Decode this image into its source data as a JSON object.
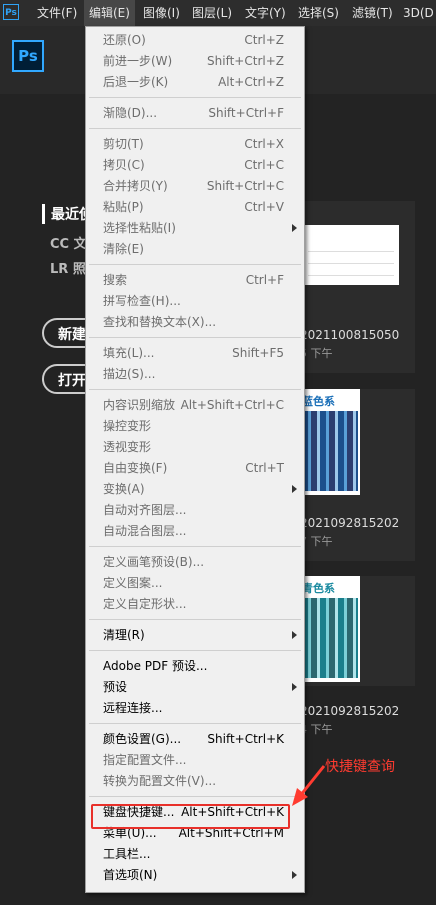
{
  "menubar": {
    "ps_badge": "Ps",
    "items": [
      {
        "label": "文件(F)",
        "active": false
      },
      {
        "label": "编辑(E)",
        "active": true
      },
      {
        "label": "图像(I)",
        "active": false
      },
      {
        "label": "图层(L)",
        "active": false
      },
      {
        "label": "文字(Y)",
        "active": false
      },
      {
        "label": "选择(S)",
        "active": false
      },
      {
        "label": "滤镜(T)",
        "active": false
      },
      {
        "label": "3D(D",
        "active": false
      }
    ]
  },
  "header": {
    "logo": "Ps"
  },
  "home": {
    "recent": "最近使",
    "cc_files": "CC 文",
    "lr_photos": "LR 照",
    "new_button": "新建",
    "open_button": "打开",
    "cards": [
      {
        "name": "2021100815050",
        "time": "5 下午",
        "thumb_title": ""
      },
      {
        "name": "2021092815202",
        "time": "7 下午",
        "thumb_title": "蓝色系"
      },
      {
        "name": "2021092815202",
        "time": "4 下午",
        "thumb_title": "青色系"
      }
    ]
  },
  "edit_menu": {
    "items": [
      {
        "label": "还原(O)",
        "shortcut": "Ctrl+Z",
        "enabled": false
      },
      {
        "label": "前进一步(W)",
        "shortcut": "Shift+Ctrl+Z",
        "enabled": false
      },
      {
        "label": "后退一步(K)",
        "shortcut": "Alt+Ctrl+Z",
        "enabled": false
      },
      {
        "sep": true
      },
      {
        "label": "渐隐(D)...",
        "shortcut": "Shift+Ctrl+F",
        "enabled": false
      },
      {
        "sep": true
      },
      {
        "label": "剪切(T)",
        "shortcut": "Ctrl+X",
        "enabled": false
      },
      {
        "label": "拷贝(C)",
        "shortcut": "Ctrl+C",
        "enabled": false
      },
      {
        "label": "合并拷贝(Y)",
        "shortcut": "Shift+Ctrl+C",
        "enabled": false
      },
      {
        "label": "粘贴(P)",
        "shortcut": "Ctrl+V",
        "enabled": false
      },
      {
        "label": "选择性粘贴(I)",
        "shortcut": "",
        "enabled": false,
        "submenu": true
      },
      {
        "label": "清除(E)",
        "shortcut": "",
        "enabled": false
      },
      {
        "sep": true
      },
      {
        "label": "搜索",
        "shortcut": "Ctrl+F",
        "enabled": false
      },
      {
        "label": "拼写检查(H)...",
        "shortcut": "",
        "enabled": false
      },
      {
        "label": "查找和替换文本(X)...",
        "shortcut": "",
        "enabled": false
      },
      {
        "sep": true
      },
      {
        "label": "填充(L)...",
        "shortcut": "Shift+F5",
        "enabled": false
      },
      {
        "label": "描边(S)...",
        "shortcut": "",
        "enabled": false
      },
      {
        "sep": true
      },
      {
        "label": "内容识别缩放",
        "shortcut": "Alt+Shift+Ctrl+C",
        "enabled": false
      },
      {
        "label": "操控变形",
        "shortcut": "",
        "enabled": false
      },
      {
        "label": "透视变形",
        "shortcut": "",
        "enabled": false
      },
      {
        "label": "自由变换(F)",
        "shortcut": "Ctrl+T",
        "enabled": false
      },
      {
        "label": "变换(A)",
        "shortcut": "",
        "enabled": false,
        "submenu": true
      },
      {
        "label": "自动对齐图层...",
        "shortcut": "",
        "enabled": false
      },
      {
        "label": "自动混合图层...",
        "shortcut": "",
        "enabled": false
      },
      {
        "sep": true
      },
      {
        "label": "定义画笔预设(B)...",
        "shortcut": "",
        "enabled": false
      },
      {
        "label": "定义图案...",
        "shortcut": "",
        "enabled": false
      },
      {
        "label": "定义自定形状...",
        "shortcut": "",
        "enabled": false
      },
      {
        "sep": true
      },
      {
        "label": "清理(R)",
        "shortcut": "",
        "enabled": true,
        "submenu": true
      },
      {
        "sep": true
      },
      {
        "label": "Adobe PDF 预设...",
        "shortcut": "",
        "enabled": true
      },
      {
        "label": "预设",
        "shortcut": "",
        "enabled": true,
        "submenu": true
      },
      {
        "label": "远程连接...",
        "shortcut": "",
        "enabled": true
      },
      {
        "sep": true
      },
      {
        "label": "颜色设置(G)...",
        "shortcut": "Shift+Ctrl+K",
        "enabled": true
      },
      {
        "label": "指定配置文件...",
        "shortcut": "",
        "enabled": false
      },
      {
        "label": "转换为配置文件(V)...",
        "shortcut": "",
        "enabled": false
      },
      {
        "sep": true
      },
      {
        "label": "键盘快捷键...",
        "shortcut": "Alt+Shift+Ctrl+K",
        "enabled": true,
        "highlight": true
      },
      {
        "label": "菜单(U)...",
        "shortcut": "Alt+Shift+Ctrl+M",
        "enabled": true
      },
      {
        "label": "工具栏...",
        "shortcut": "",
        "enabled": true
      },
      {
        "label": "首选项(N)",
        "shortcut": "",
        "enabled": true,
        "submenu": true
      }
    ]
  },
  "annotation": {
    "text": "快捷键查询",
    "color": "#ff3b30"
  }
}
